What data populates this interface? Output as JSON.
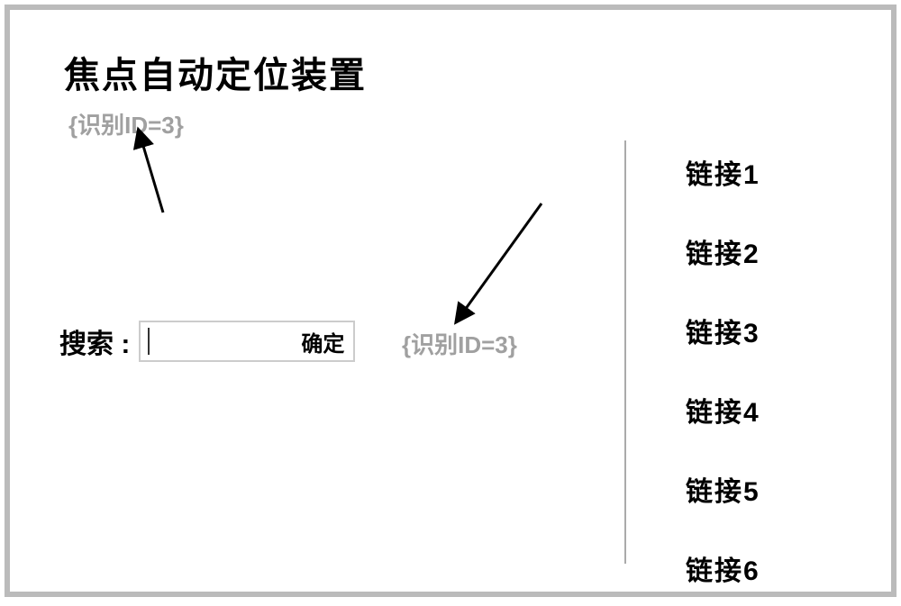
{
  "title": "焦点自动定位装置",
  "annotations": {
    "top": "{识别ID=3}",
    "right": "{识别ID=3}"
  },
  "search": {
    "label": "搜索 :",
    "confirm": "确定"
  },
  "links": [
    "链接1",
    "链接2",
    "链接3",
    "链接4",
    "链接5",
    "链接6"
  ]
}
